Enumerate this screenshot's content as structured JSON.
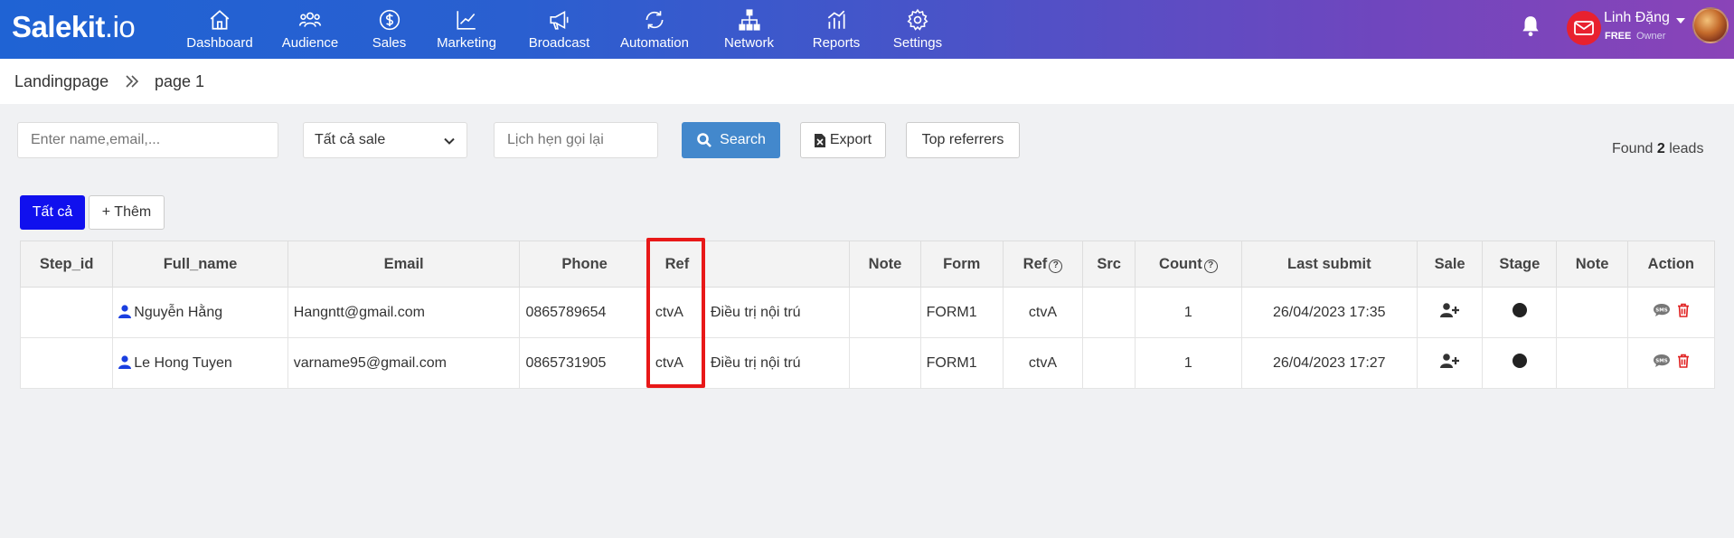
{
  "brand": {
    "logo_main": "Salekit",
    "logo_suffix": ".io"
  },
  "nav": [
    {
      "label": "Dashboard",
      "icon": "home-icon"
    },
    {
      "label": "Audience",
      "icon": "users-icon"
    },
    {
      "label": "Sales",
      "icon": "dollar-icon"
    },
    {
      "label": "Marketing",
      "icon": "chart-line-icon"
    },
    {
      "label": "Broadcast",
      "icon": "megaphone-icon"
    },
    {
      "label": "Automation",
      "icon": "automation-icon"
    },
    {
      "label": "Network",
      "icon": "network-icon"
    },
    {
      "label": "Reports",
      "icon": "bar-chart-icon"
    },
    {
      "label": "Settings",
      "icon": "gear-icon"
    }
  ],
  "user": {
    "name": "Linh Đặng",
    "plan": "FREE",
    "role": "Owner"
  },
  "breadcrumb": {
    "root": "Landingpage",
    "current": "page 1"
  },
  "filters": {
    "search_placeholder": "Enter name,email,...",
    "sale_select": "Tất cả sale",
    "callback_placeholder": "Lịch hẹn gọi lại",
    "search_label": "Search",
    "export_label": "Export",
    "top_referrers_label": "Top referrers"
  },
  "found": {
    "prefix": "Found",
    "count": "2",
    "suffix": "leads"
  },
  "tabs": {
    "all": "Tất cả",
    "add": "+ Thêm"
  },
  "table": {
    "headers": [
      "Step_id",
      "Full_name",
      "Email",
      "Phone",
      "Ref",
      "",
      "Note",
      "Form",
      "Ref",
      "Src",
      "Count",
      "Last submit",
      "Sale",
      "Stage",
      "Note",
      "Action"
    ],
    "rows": [
      {
        "step_id": "",
        "full_name": "Nguyễn Hằng",
        "email": "Hangntt@gmail.com",
        "phone": "0865789654",
        "ref": "ctvA",
        "extra": "Điều trị nội trú",
        "note": "",
        "form": "FORM1",
        "ref2": "ctvA",
        "src": "",
        "count": "1",
        "last_submit": "26/04/2023 17:35",
        "note2": ""
      },
      {
        "step_id": "",
        "full_name": "Le Hong Tuyen",
        "email": "varname95@gmail.com",
        "phone": "0865731905",
        "ref": "ctvA",
        "extra": "Điều trị nội trú",
        "note": "",
        "form": "FORM1",
        "ref2": "ctvA",
        "src": "",
        "count": "1",
        "last_submit": "26/04/2023 17:27",
        "note2": ""
      }
    ]
  },
  "colors": {
    "primary": "#4388cc",
    "tab_active": "#1010ee",
    "highlight": "#e81818",
    "mail_badge": "#e8212f"
  }
}
